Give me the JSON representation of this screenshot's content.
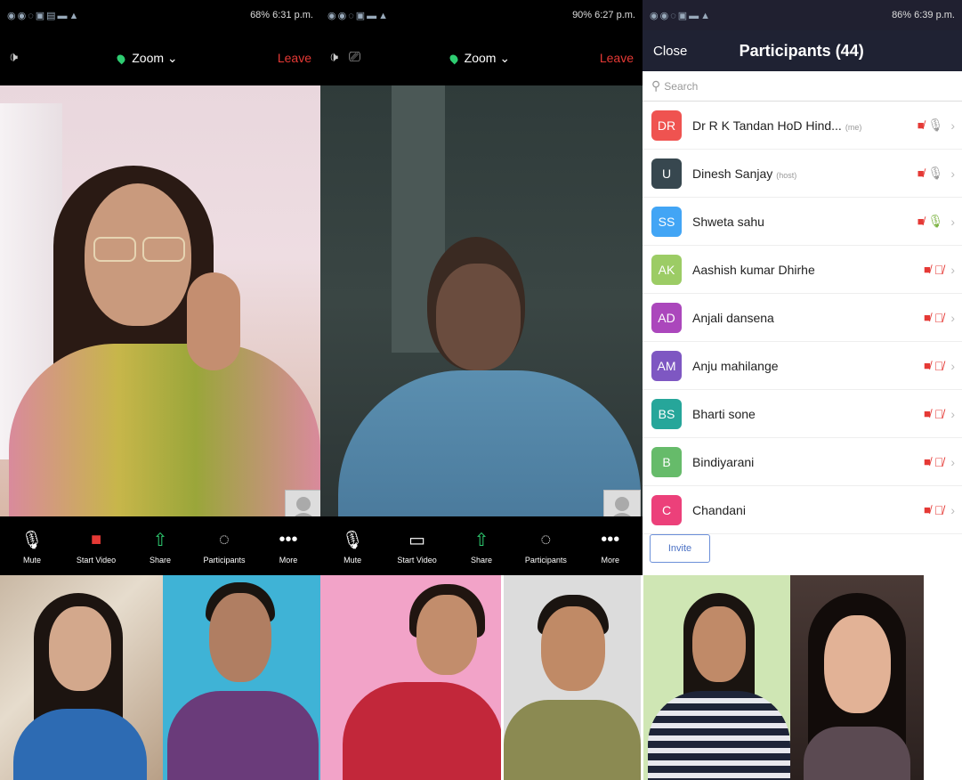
{
  "left_phone": {
    "status_time": "68% 6:31 p.m.",
    "zoom_label": "Zoom",
    "leave_label": "Leave",
    "controls": [
      {
        "label": "Mute",
        "icon": "mic-icon"
      },
      {
        "label": "Start Video",
        "icon": "video-off-icon"
      },
      {
        "label": "Share",
        "icon": "share-icon"
      },
      {
        "label": "Participants",
        "icon": "participants-icon"
      },
      {
        "label": "More",
        "icon": "more-icon"
      }
    ]
  },
  "mid_phone": {
    "status_time": "90% 6:27 p.m.",
    "zoom_label": "Zoom",
    "leave_label": "Leave",
    "controls": [
      {
        "label": "Mute",
        "icon": "mic-icon"
      },
      {
        "label": "Start Video",
        "icon": "video-off-icon"
      },
      {
        "label": "Share",
        "icon": "share-icon"
      },
      {
        "label": "Participants",
        "icon": "participants-icon"
      },
      {
        "label": "More",
        "icon": "more-icon"
      }
    ]
  },
  "participants_panel": {
    "status_time": "86% 6:39 p.m.",
    "close_label": "Close",
    "title": "Participants (44)",
    "search_placeholder": "Search",
    "invite_label": "Invite",
    "participants": [
      {
        "initials": "DR",
        "name": "Dr R K Tandan HoD Hind...",
        "tag": "(me)",
        "color": "#ef5350",
        "mic": "grey"
      },
      {
        "initials": "U",
        "name": "Dinesh Sanjay",
        "tag": "(host)",
        "color": "#37474f",
        "mic": "grey"
      },
      {
        "initials": "SS",
        "name": "Shweta sahu",
        "tag": "",
        "color": "#42a5f5",
        "mic": "on"
      },
      {
        "initials": "AK",
        "name": "Aashish kumar Dhirhe",
        "tag": "",
        "color": "#9ccc65",
        "mic": "off"
      },
      {
        "initials": "AD",
        "name": "Anjali dansena",
        "tag": "",
        "color": "#ab47bc",
        "mic": "off"
      },
      {
        "initials": "AM",
        "name": "Anju mahilange",
        "tag": "",
        "color": "#7e57c2",
        "mic": "off"
      },
      {
        "initials": "BS",
        "name": "Bharti sone",
        "tag": "",
        "color": "#26a69a",
        "mic": "off"
      },
      {
        "initials": "B",
        "name": "Bindiyarani",
        "tag": "",
        "color": "#66bb6a",
        "mic": "off"
      },
      {
        "initials": "C",
        "name": "Chandani",
        "tag": "",
        "color": "#ec407a",
        "mic": "off"
      }
    ]
  },
  "colors": {
    "zoom_green": "#2ecc71",
    "leave_red": "#e53935",
    "header_navy": "#1f2233"
  }
}
